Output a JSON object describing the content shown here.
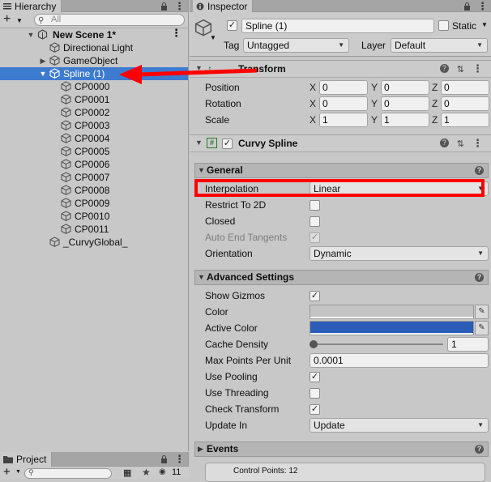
{
  "hierarchy": {
    "tab_title": "Hierarchy",
    "search_placeholder": "All",
    "items": [
      {
        "label": "New Scene 1*",
        "indent": 0
      },
      {
        "label": "Directional Light",
        "indent": 1
      },
      {
        "label": "GameObject",
        "indent": 1
      },
      {
        "label": "Spline (1)",
        "indent": 1
      },
      {
        "label": "CP0000",
        "indent": 2
      },
      {
        "label": "CP0001",
        "indent": 2
      },
      {
        "label": "CP0002",
        "indent": 2
      },
      {
        "label": "CP0003",
        "indent": 2
      },
      {
        "label": "CP0004",
        "indent": 2
      },
      {
        "label": "CP0005",
        "indent": 2
      },
      {
        "label": "CP0006",
        "indent": 2
      },
      {
        "label": "CP0007",
        "indent": 2
      },
      {
        "label": "CP0008",
        "indent": 2
      },
      {
        "label": "CP0009",
        "indent": 2
      },
      {
        "label": "CP0010",
        "indent": 2
      },
      {
        "label": "CP0011",
        "indent": 2
      },
      {
        "label": "_CurvyGlobal_",
        "indent": 0
      }
    ]
  },
  "project": {
    "tab_title": "Project",
    "hidden_count": "11"
  },
  "inspector": {
    "tab_title": "Inspector",
    "object_name": "Spline (1)",
    "static_label": "Static",
    "tag_label": "Tag",
    "tag_value": "Untagged",
    "layer_label": "Layer",
    "layer_value": "Default",
    "transform": {
      "title": "Transform",
      "axis_x": "X",
      "axis_y": "Y",
      "axis_z": "Z",
      "position_label": "Position",
      "rotation_label": "Rotation",
      "scale_label": "Scale",
      "position": [
        "0",
        "0",
        "0"
      ],
      "rotation": [
        "0",
        "0",
        "0"
      ],
      "scale": [
        "1",
        "1",
        "1"
      ]
    },
    "curvy_spline": {
      "title": "Curvy Spline",
      "general_title": "General",
      "interpolation_label": "Interpolation",
      "interpolation_value": "Linear",
      "restrict_label": "Restrict To 2D",
      "closed_label": "Closed",
      "auto_end_label": "Auto End Tangents",
      "orientation_label": "Orientation",
      "orientation_value": "Dynamic",
      "advanced_title": "Advanced Settings",
      "show_gizmos_label": "Show Gizmos",
      "color_label": "Color",
      "active_color_label": "Active Color",
      "cache_density_label": "Cache Density",
      "cache_density_value": "1",
      "max_points_label": "Max Points Per Unit",
      "max_points_value": "0.0001",
      "use_pooling_label": "Use Pooling",
      "use_threading_label": "Use Threading",
      "check_transform_label": "Check Transform",
      "update_in_label": "Update In",
      "update_in_value": "Update",
      "events_title": "Events",
      "control_points_text": "Control Points: 12"
    },
    "colors": {
      "color_swatch": "#c4c4c4",
      "active_color_swatch": "#2b5cb8",
      "selection": "#3d7bd0"
    }
  }
}
